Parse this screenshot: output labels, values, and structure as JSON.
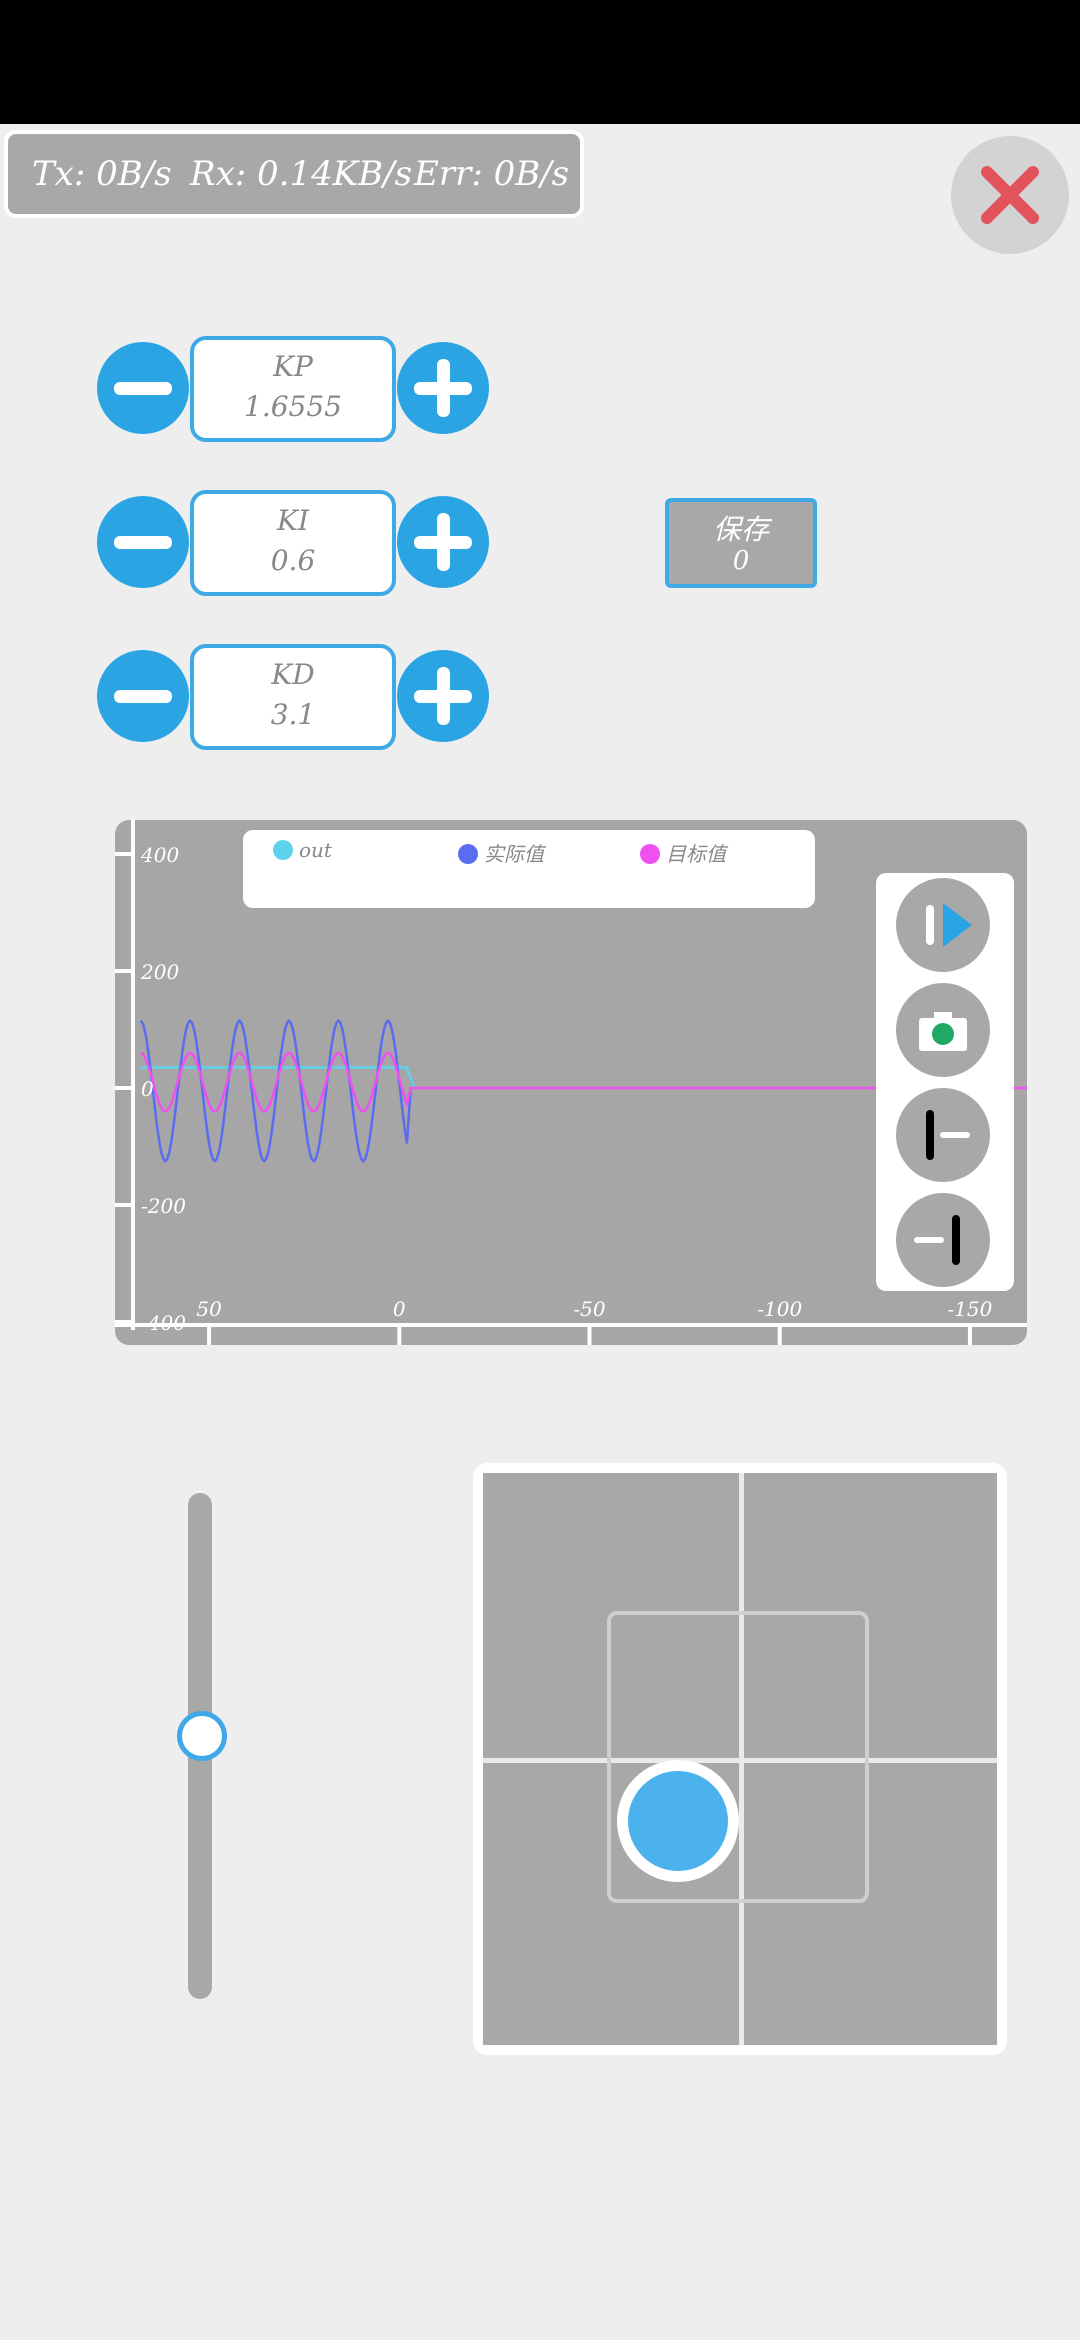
{
  "stats": {
    "tx": "Tx: 0B/s",
    "rx": "Rx: 0.14KB/s",
    "err": "Err: 0B/s"
  },
  "params": [
    {
      "name": "KP",
      "value": "1.6555"
    },
    {
      "name": "KI",
      "value": "0.6"
    },
    {
      "name": "KD",
      "value": "3.1"
    }
  ],
  "save": {
    "label": "保存",
    "value": "0"
  },
  "chart_data": {
    "type": "line",
    "series": [
      {
        "name": "out",
        "color": "#5bd3ea"
      },
      {
        "name": "实际值",
        "color": "#5a6cf0"
      },
      {
        "name": "目标值",
        "color": "#f050f0"
      }
    ],
    "y_ticks": [
      "400",
      "200",
      "0",
      "-200",
      "-400"
    ],
    "x_ticks": [
      "50",
      "0",
      "-50",
      "-100",
      "-150"
    ],
    "ylim": [
      -400,
      400
    ],
    "xlim": [
      70,
      -165
    ],
    "x_reversed": true,
    "legend_position": "top"
  },
  "colors": {
    "accent": "#2aa4e2",
    "panel": "#a8a8a8",
    "background": "#eeeeee"
  },
  "icons": {
    "close": "close-icon",
    "minus": "minus-icon",
    "plus": "plus-icon",
    "play": "play-icon",
    "camera": "camera-icon",
    "left_bracket": "left-bracket-icon",
    "right_bracket": "right-bracket-icon"
  },
  "slider": {
    "level": 0.48
  },
  "joystick": {
    "x": -0.14,
    "y": -0.14
  }
}
